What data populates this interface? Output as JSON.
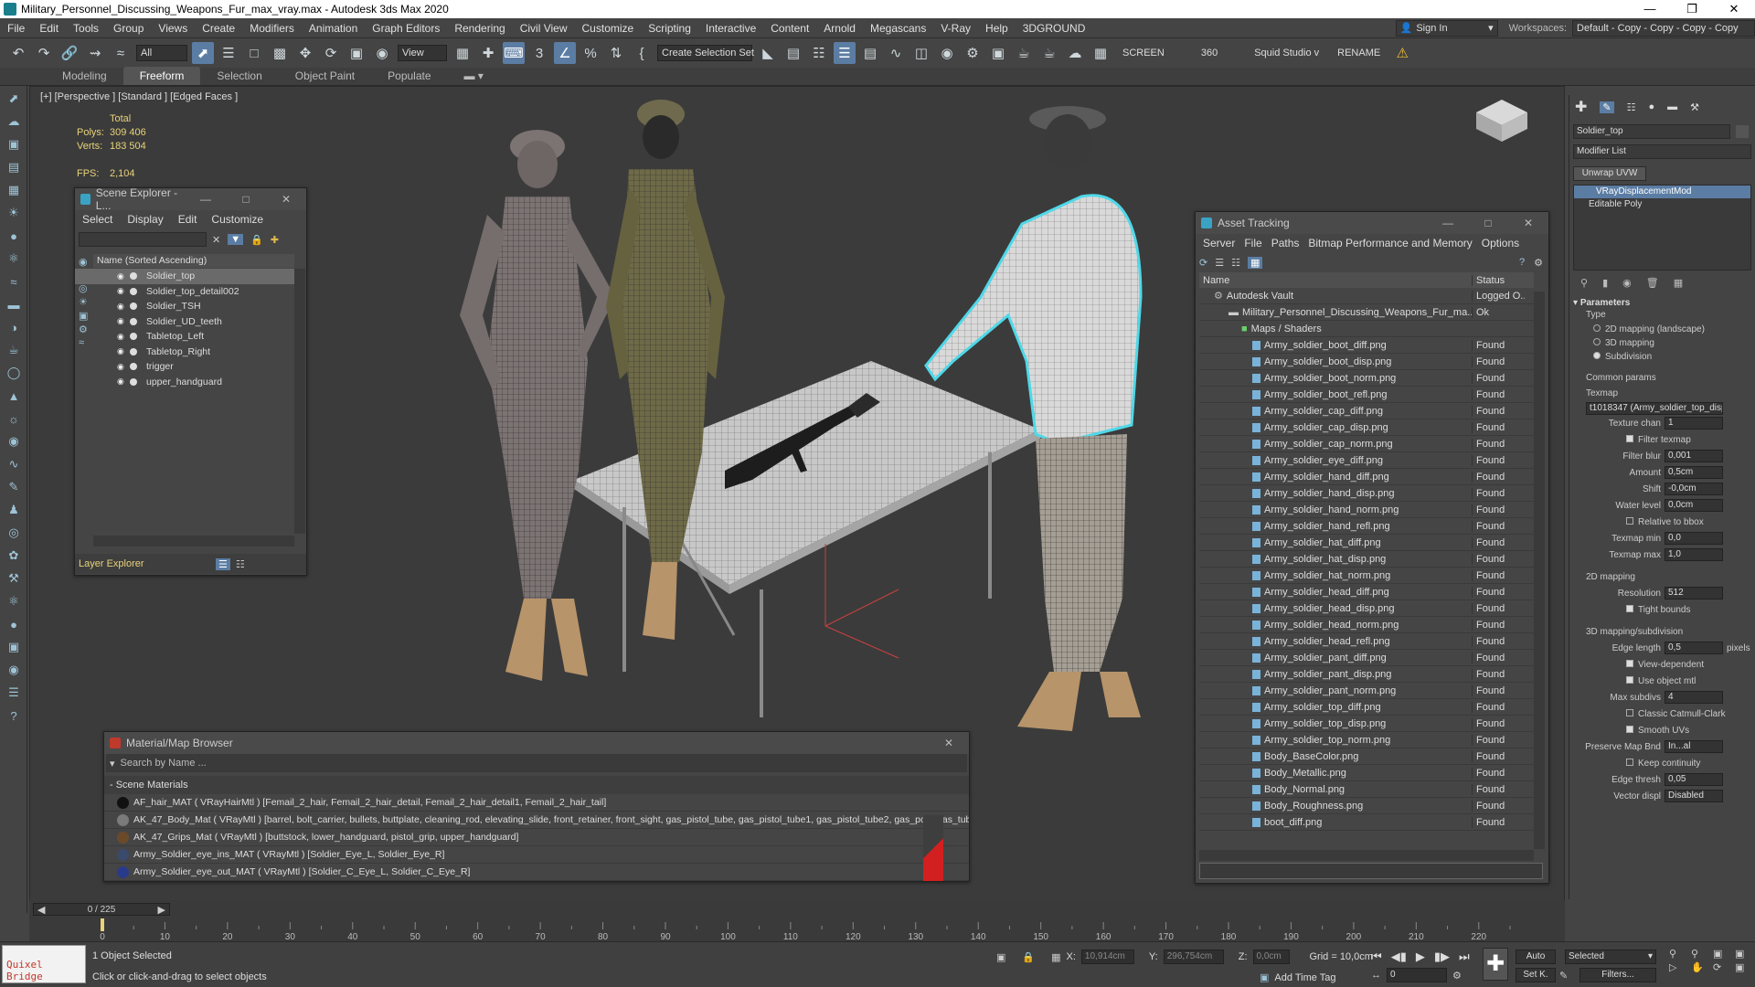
{
  "window": {
    "title": "Military_Personnel_Discussing_Weapons_Fur_max_vray.max - Autodesk 3ds Max 2020"
  },
  "menu": [
    "File",
    "Edit",
    "Tools",
    "Group",
    "Views",
    "Create",
    "Modifiers",
    "Animation",
    "Graph Editors",
    "Rendering",
    "Civil View",
    "Customize",
    "Scripting",
    "Interactive",
    "Content",
    "Arnold",
    "Megascans",
    "V-Ray",
    "Help",
    "3DGROUND"
  ],
  "signin": "Sign In",
  "workspaces": {
    "label": "Workspaces:",
    "value": "Default - Copy - Copy - Copy - Copy"
  },
  "toolbar": {
    "filter": "All",
    "view": "View",
    "selection_set": "Create Selection Set",
    "screen": "SCREEN",
    "value360": "360",
    "squid": "Squid Studio v",
    "rename": "RENAME"
  },
  "ribbon": [
    "Modeling",
    "Freeform",
    "Selection",
    "Object Paint",
    "Populate"
  ],
  "viewport": {
    "label": "[+] [Perspective ] [Standard ] [Edged Faces ]",
    "stats": {
      "total_label": "Total",
      "polys_label": "Polys:",
      "polys": "309 406",
      "verts_label": "Verts:",
      "verts": "183 504",
      "fps_label": "FPS:",
      "fps": "2,104"
    }
  },
  "scene_explorer": {
    "title": "Scene Explorer - L...",
    "menu": [
      "Select",
      "Display",
      "Edit",
      "Customize"
    ],
    "header": "Name (Sorted Ascending)",
    "items": [
      "Soldier_top",
      "Soldier_top_detail002",
      "Soldier_TSH",
      "Soldier_UD_teeth",
      "Tabletop_Left",
      "Tabletop_Right",
      "trigger",
      "upper_handguard"
    ],
    "footer": "Layer Explorer"
  },
  "asset_tracking": {
    "title": "Asset Tracking",
    "menu": [
      "Server",
      "File",
      "Paths",
      "Bitmap Performance and Memory",
      "Options"
    ],
    "col_name": "Name",
    "col_status": "Status",
    "vault": {
      "name": "Autodesk Vault",
      "status": "Logged O..."
    },
    "file": {
      "name": "Military_Personnel_Discussing_Weapons_Fur_ma...",
      "status": "Ok"
    },
    "group": "Maps / Shaders",
    "maps": [
      {
        "name": "Army_soldier_boot_diff.png",
        "status": "Found"
      },
      {
        "name": "Army_soldier_boot_disp.png",
        "status": "Found"
      },
      {
        "name": "Army_soldier_boot_norm.png",
        "status": "Found"
      },
      {
        "name": "Army_soldier_boot_refl.png",
        "status": "Found"
      },
      {
        "name": "Army_soldier_cap_diff.png",
        "status": "Found"
      },
      {
        "name": "Army_soldier_cap_disp.png",
        "status": "Found"
      },
      {
        "name": "Army_soldier_cap_norm.png",
        "status": "Found"
      },
      {
        "name": "Army_soldier_eye_diff.png",
        "status": "Found"
      },
      {
        "name": "Army_soldier_hand_diff.png",
        "status": "Found"
      },
      {
        "name": "Army_soldier_hand_disp.png",
        "status": "Found"
      },
      {
        "name": "Army_soldier_hand_norm.png",
        "status": "Found"
      },
      {
        "name": "Army_soldier_hand_refl.png",
        "status": "Found"
      },
      {
        "name": "Army_soldier_hat_diff.png",
        "status": "Found"
      },
      {
        "name": "Army_soldier_hat_disp.png",
        "status": "Found"
      },
      {
        "name": "Army_soldier_hat_norm.png",
        "status": "Found"
      },
      {
        "name": "Army_soldier_head_diff.png",
        "status": "Found"
      },
      {
        "name": "Army_soldier_head_disp.png",
        "status": "Found"
      },
      {
        "name": "Army_soldier_head_norm.png",
        "status": "Found"
      },
      {
        "name": "Army_soldier_head_refl.png",
        "status": "Found"
      },
      {
        "name": "Army_soldier_pant_diff.png",
        "status": "Found"
      },
      {
        "name": "Army_soldier_pant_disp.png",
        "status": "Found"
      },
      {
        "name": "Army_soldier_pant_norm.png",
        "status": "Found"
      },
      {
        "name": "Army_soldier_top_diff.png",
        "status": "Found"
      },
      {
        "name": "Army_soldier_top_disp.png",
        "status": "Found"
      },
      {
        "name": "Army_soldier_top_norm.png",
        "status": "Found"
      },
      {
        "name": "Body_BaseColor.png",
        "status": "Found"
      },
      {
        "name": "Body_Metallic.png",
        "status": "Found"
      },
      {
        "name": "Body_Normal.png",
        "status": "Found"
      },
      {
        "name": "Body_Roughness.png",
        "status": "Found"
      },
      {
        "name": "boot_diff.png",
        "status": "Found"
      }
    ]
  },
  "material_browser": {
    "title": "Material/Map Browser",
    "search_placeholder": "Search by Name ...",
    "section": "- Scene Materials",
    "rows": [
      "AF_hair_MAT  ( VRayHairMtl )  [Femail_2_hair, Femail_2_hair_detail, Femail_2_hair_detail1, Femail_2_hair_tail]",
      "AK_47_Body_Mat  ( VRayMtl )  [barrel, bolt_carrier, bullets, buttplate, cleaning_rod, elevating_slide, front_retainer, front_sight, gas_pistol_tube, gas_pistol_tube1, gas_pistol_tube2, gas_port, gas_tub...",
      "AK_47_Grips_Mat  ( VRayMtl )  [buttstock, lower_handguard, pistol_grip, upper_handguard]",
      "Army_Soldier_eye_ins_MAT  ( VRayMtl )  [Soldier_Eye_L, Soldier_Eye_R]",
      "Army_Soldier_eye_out_MAT  ( VRayMtl )  [Soldier_C_Eye_L, Soldier_C_Eye_R]"
    ]
  },
  "command_panel": {
    "object_name": "Soldier_top",
    "modifier_list": "Modifier List",
    "unwrap_btn": "Unwrap UVW",
    "stack": [
      "VRayDisplacementMod",
      "Editable Poly"
    ],
    "params_title": "Parameters",
    "type_label": "Type",
    "type_options": [
      "2D mapping (landscape)",
      "3D mapping",
      "Subdivision"
    ],
    "common_label": "Common params",
    "texmap_label": "Texmap",
    "texmap_value": "t1018347 (Army_soldier_top_disp",
    "texture_chan_label": "Texture chan",
    "texture_chan": "1",
    "filter_texmap": "Filter texmap",
    "filter_blur_label": "Filter blur",
    "filter_blur": "0,001",
    "amount_label": "Amount",
    "amount": "0,5cm",
    "shift_label": "Shift",
    "shift": "-0,0cm",
    "water_label": "Water level",
    "water": "0,0cm",
    "relative_bbox": "Relative to bbox",
    "texmap_min_label": "Texmap min",
    "texmap_min": "0,0",
    "texmap_max_label": "Texmap max",
    "texmap_max": "1,0",
    "map2d_label": "2D mapping",
    "resolution_label": "Resolution",
    "resolution": "512",
    "tight_bounds": "Tight bounds",
    "map3d_label": "3D mapping/subdivision",
    "edge_length_label": "Edge length",
    "edge_length": "0,5",
    "pixels": "pixels",
    "view_dependent": "View-dependent",
    "use_object_mtl": "Use object mtl",
    "max_subdivs_label": "Max subdivs",
    "max_subdivs": "4",
    "classic_catmull": "Classic Catmull-Clark",
    "smooth_uvs": "Smooth UVs",
    "preserve_map_label": "Preserve Map Bnd",
    "preserve_map": "In...al",
    "keep_continuity": "Keep continuity",
    "edge_thresh_label": "Edge thresh",
    "edge_thresh": "0,05",
    "vector_displ_label": "Vector displ",
    "vector_displ": "Disabled"
  },
  "timeline": {
    "frame": "0 / 225",
    "ticks": [
      "0",
      "10",
      "20",
      "30",
      "40",
      "50",
      "60",
      "70",
      "80",
      "90",
      "100",
      "110",
      "120",
      "130",
      "140",
      "150",
      "160",
      "170",
      "180",
      "190",
      "200",
      "210",
      "220"
    ]
  },
  "status": {
    "quixel": "Quixel Bridge",
    "selected": "1 Object Selected",
    "hint": "Click or click-and-drag to select objects",
    "x_label": "X:",
    "x": "10,914cm",
    "y_label": "Y:",
    "y": "296,754cm",
    "z_label": "Z:",
    "z": "0,0cm",
    "grid": "Grid = 10,0cm",
    "add_time_tag": "Add Time Tag",
    "auto": "Auto",
    "set_k": "Set K.",
    "selected_dropdown": "Selected",
    "filters": "Filters...",
    "frame_value": "0"
  }
}
